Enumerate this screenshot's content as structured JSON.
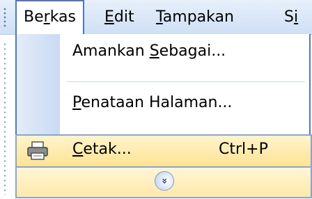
{
  "menubar": {
    "items": [
      {
        "pre": "Be",
        "u": "r",
        "post": "kas"
      },
      {
        "pre": "",
        "u": "E",
        "post": "dit"
      },
      {
        "pre": "",
        "u": "T",
        "post": "ampakan"
      },
      {
        "pre": "S",
        "u": "i",
        "post": ""
      }
    ]
  },
  "dropdown": {
    "items": [
      {
        "pre": "Amankan ",
        "u": "S",
        "post": "ebagai..."
      },
      {
        "pre": "",
        "u": "P",
        "post": "enataan Halaman..."
      },
      {
        "pre": "",
        "u": "C",
        "post": "etak...",
        "shortcut": "Ctrl+P",
        "icon": "printer-icon"
      }
    ],
    "expand_icon": "chevron-double-down-icon"
  },
  "colors": {
    "menu_border": "#5276b5",
    "highlight": "#ffe394",
    "icon_column": "#c9daf2"
  }
}
